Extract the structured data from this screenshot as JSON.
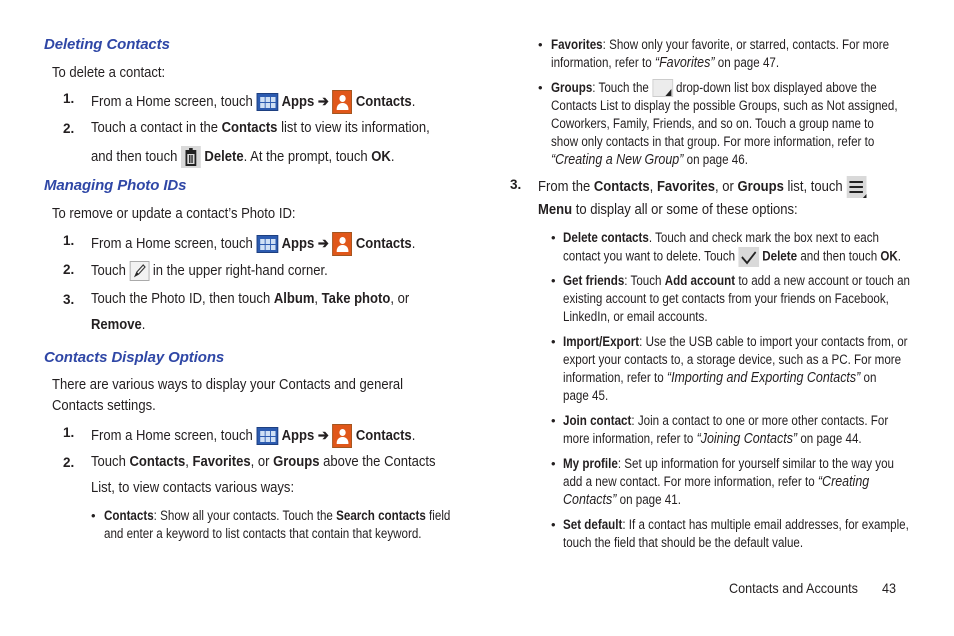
{
  "left": {
    "sections": [
      {
        "heading": "Deleting Contacts",
        "intro": "To delete a contact:",
        "steps": [
          {
            "num": "1.",
            "pre": "From a Home screen, touch",
            "apps": "Apps",
            "arrow": "➔",
            "contacts": "Contacts",
            "end": "."
          },
          {
            "num": "2.",
            "line1_pre": "Touch a contact in the",
            "line1_bold": "Contacts",
            "line1_post": "list to view its information,",
            "line2_pre": "and then touch",
            "line2_bold": "Delete",
            "line2_mid": ". At the prompt, touch",
            "line2_bold2": "OK",
            "line2_end": "."
          }
        ]
      },
      {
        "heading": "Managing Photo IDs",
        "intro": "To remove or update a contact’s Photo ID:",
        "steps": [
          {
            "num": "1.",
            "pre": "From a Home screen, touch",
            "apps": "Apps",
            "arrow": "➔",
            "contacts": "Contacts",
            "end": "."
          },
          {
            "num": "2.",
            "pre": "Touch",
            "post": "in the upper right-hand corner."
          },
          {
            "num": "3.",
            "line1_pre": "Touch the Photo ID, then touch",
            "b1": "Album",
            "sep1": ",",
            "b2": "Take photo",
            "sep2": ", or",
            "b3": "Remove",
            "end": "."
          }
        ]
      },
      {
        "heading": "Contacts Display Options",
        "intro1": "There are various ways to display your Contacts and general",
        "intro2": "Contacts settings.",
        "steps": [
          {
            "num": "1.",
            "pre": "From a Home screen, touch",
            "apps": "Apps",
            "arrow": "➔",
            "contacts": "Contacts",
            "end": "."
          },
          {
            "num": "2.",
            "pre": "Touch",
            "b1": "Contacts",
            "sep1": ",",
            "b2": "Favorites",
            "sep2": ", or",
            "b3": "Groups",
            "post": "above the Contacts",
            "line2": "List, to view contacts various ways:"
          }
        ],
        "bullet": {
          "bold": "Contacts",
          "text1": ": Show all your contacts. Touch the",
          "bold2": "Search contacts",
          "text2": "field",
          "line2": "and enter a keyword to list contacts that contain that keyword."
        }
      }
    ]
  },
  "right": {
    "favorites": {
      "bold": "Favorites",
      "text1": ": Show only your favorite, or starred, contacts. For more",
      "line2_pre": "information, refer to",
      "ref": "“Favorites”",
      "line2_post": "on page 47."
    },
    "groups": {
      "bold": "Groups",
      "text1": ": Touch the",
      "text2": "drop-down list box displayed above the",
      "line2": "Contacts List to display the possible Groups, such as Not assigned,",
      "line3": "Coworkers, Family, Friends, and so on. Touch a group name to",
      "line4": "show only contacts in that group. For more information, refer to",
      "ref": "“Creating a New Group”",
      "line5_post": "on page 46."
    },
    "step3": {
      "num": "3.",
      "pre": "From the",
      "b1": "Contacts",
      "sep1": ",",
      "b2": "Favorites",
      "sep2": ", or",
      "b3": "Groups",
      "post": "list, touch",
      "line2_bold": "Menu",
      "line2": "to display all or some of these options:"
    },
    "options": [
      {
        "bold": "Delete contacts",
        "line1": ". Touch and check mark the box next to each",
        "line2_pre": "contact you want to delete. Touch",
        "line2_bold": "Delete",
        "line2_mid": "and then touch",
        "line2_bold2": "OK",
        "line2_end": "."
      },
      {
        "bold": "Get friends",
        "line1_pre": ": Touch",
        "line1_bold": "Add account",
        "line1_post": "to add a new account or touch an",
        "line2": "existing account to get contacts from your friends on Facebook,",
        "line3": "LinkedIn, or email accounts."
      },
      {
        "bold": "Import/Export",
        "line1": ": Use the USB cable to import your contacts from, or",
        "line2": "export your contacts to, a storage device, such as a PC. For more",
        "line3_pre": "information, refer to",
        "ref": "“Importing and Exporting Contacts”",
        "line3_post": "on",
        "line4": "page 45."
      },
      {
        "bold": "Join contact",
        "line1": ": Join a contact to one or more other contacts. For",
        "line2_pre": "more information, refer to",
        "ref": "“Joining Contacts”",
        "line2_post": "on page 44."
      },
      {
        "bold": "My profile",
        "line1": ": Set up information for yourself similar to the way you",
        "line2_pre": "add a new contact. For more information, refer to",
        "ref1": "“Creating",
        "ref2": "Contacts”",
        "line3_post": "on page 41."
      },
      {
        "bold": "Set default",
        "line1": ": If a contact has multiple email addresses, for example,",
        "line2": "touch the field that should be the default value."
      }
    ]
  },
  "footer": {
    "section": "Contacts and Accounts",
    "page": "43"
  }
}
